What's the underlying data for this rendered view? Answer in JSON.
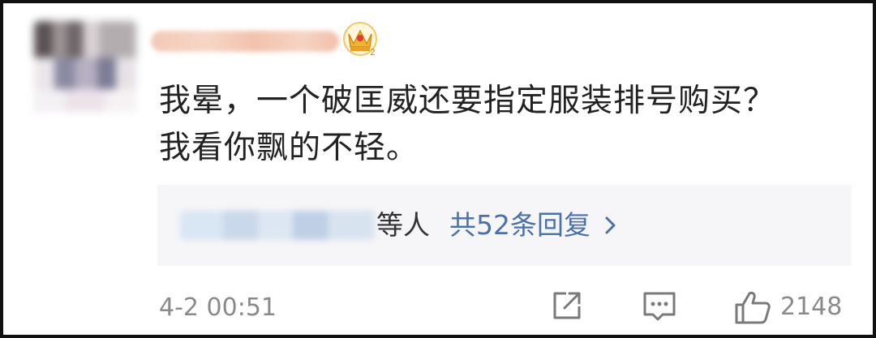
{
  "comment": {
    "lines": [
      "我晕，一个破匡威还要指定服装排号购买？",
      "我看你飘的不轻。"
    ]
  },
  "replies": {
    "suffix": "等人",
    "link": "共52条回复"
  },
  "meta": {
    "timestamp": "4-2 00:51",
    "like_count": "2148"
  },
  "icons": {
    "crown": "crown-badge-icon",
    "share": "share-icon",
    "comment": "comment-icon",
    "like": "thumbs-up-icon",
    "chevron": "chevron-right-icon"
  },
  "colors": {
    "link": "#4a72a8",
    "muted": "#8a8a8a",
    "crown": "#f0b43a"
  }
}
